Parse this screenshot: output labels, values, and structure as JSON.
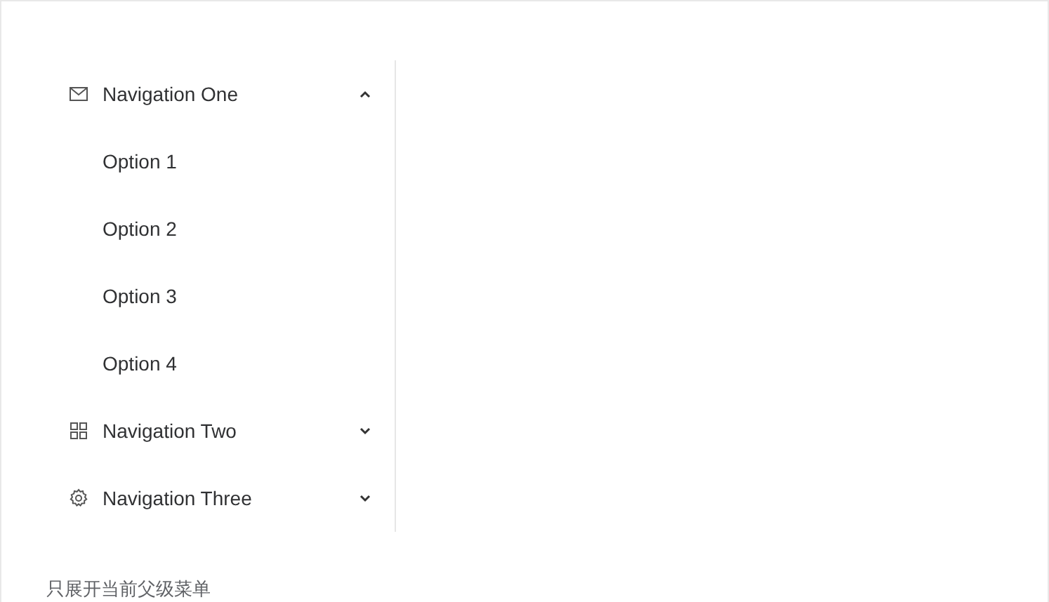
{
  "menu": [
    {
      "kind": "mail",
      "label": "Navigation One",
      "expanded": true,
      "children": [
        {
          "label": "Option 1"
        },
        {
          "label": "Option 2"
        },
        {
          "label": "Option 3"
        },
        {
          "label": "Option 4"
        }
      ]
    },
    {
      "kind": "grid",
      "label": "Navigation Two",
      "expanded": false
    },
    {
      "kind": "gear",
      "label": "Navigation Three",
      "expanded": false
    }
  ],
  "caption": "只展开当前父级菜单"
}
